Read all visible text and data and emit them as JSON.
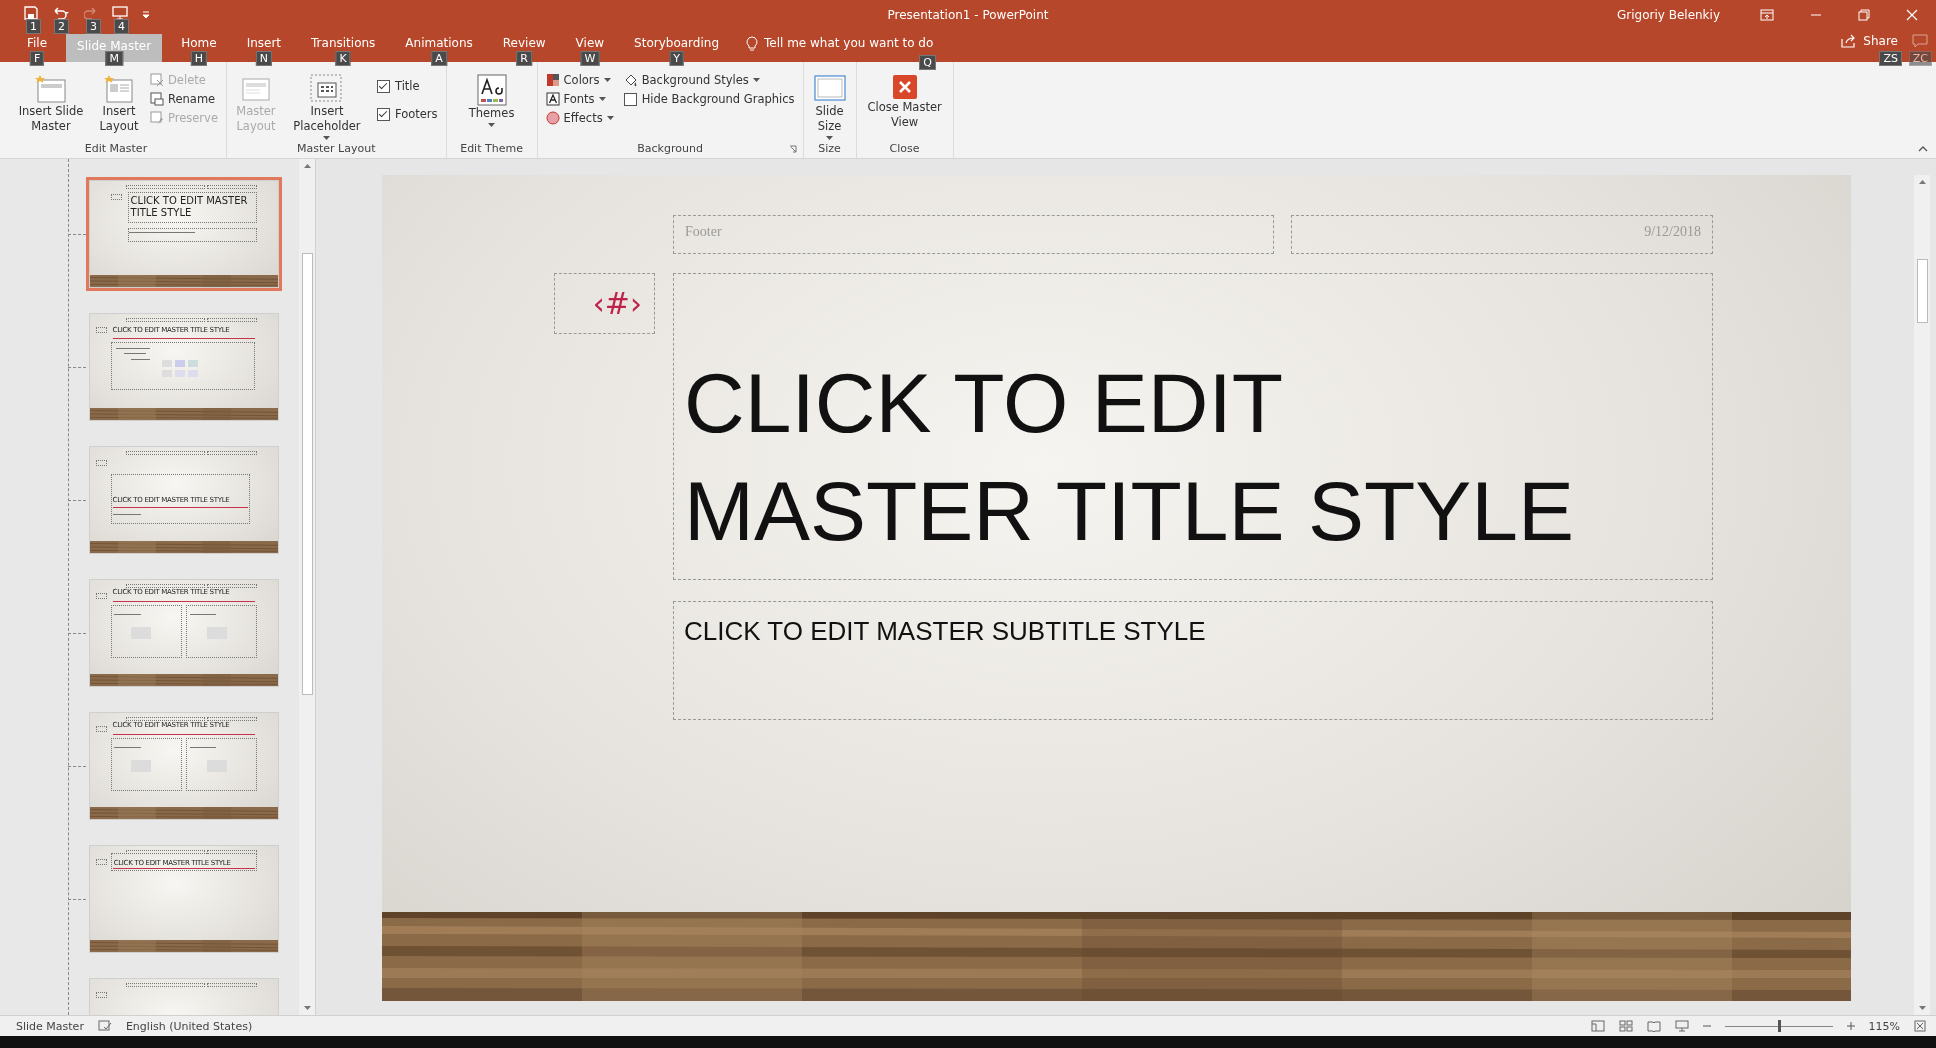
{
  "title_bar": {
    "quick_access": [
      {
        "kind": "save",
        "key_tip": "1",
        "disabled": false
      },
      {
        "kind": "undo",
        "key_tip": "2",
        "disabled": false
      },
      {
        "kind": "redo",
        "key_tip": "3",
        "disabled": true
      },
      {
        "kind": "present",
        "key_tip": "4",
        "disabled": false
      }
    ],
    "title": "Presentation1  -  PowerPoint",
    "user": "Grigoriy Belenkiy"
  },
  "tabs": [
    {
      "label": "File",
      "key_tip": "F",
      "selected": false
    },
    {
      "label": "Slide Master",
      "key_tip": "M",
      "selected": true
    },
    {
      "label": "Home",
      "key_tip": "H",
      "selected": false
    },
    {
      "label": "Insert",
      "key_tip": "N",
      "selected": false
    },
    {
      "label": "Transitions",
      "key_tip": "K",
      "selected": false
    },
    {
      "label": "Animations",
      "key_tip": "A",
      "selected": false
    },
    {
      "label": "Review",
      "key_tip": "R",
      "selected": false
    },
    {
      "label": "View",
      "key_tip": "W",
      "selected": false
    },
    {
      "label": "Storyboarding",
      "key_tip": "Y",
      "selected": false
    }
  ],
  "tell_me": {
    "placeholder": "Tell me what you want to do",
    "key_tip": "Q"
  },
  "share": {
    "label": "Share",
    "key_tip": "ZS"
  },
  "comments": {
    "key_tip": "ZC"
  },
  "ribbon": {
    "edit_master": {
      "label": "Edit Master",
      "insert_slide_master": "Insert Slide Master",
      "insert_layout": "Insert Layout",
      "delete": {
        "label": "Delete",
        "disabled": true
      },
      "rename": {
        "label": "Rename",
        "disabled": false
      },
      "preserve": {
        "label": "Preserve",
        "disabled": true
      }
    },
    "master_layout": {
      "label": "Master Layout",
      "master_layout": {
        "label": "Master Layout",
        "disabled": true
      },
      "insert_placeholder": "Insert Placeholder",
      "title": {
        "label": "Title",
        "checked": true
      },
      "footers": {
        "label": "Footers",
        "checked": true
      }
    },
    "edit_theme": {
      "label": "Edit Theme",
      "themes": "Themes"
    },
    "background": {
      "label": "Background",
      "colors": "Colors",
      "fonts": "Fonts",
      "effects": "Effects",
      "background_styles": "Background Styles",
      "hide_background_graphics": {
        "label": "Hide Background Graphics",
        "checked": false
      }
    },
    "size": {
      "label": "Size",
      "slide_size": "Slide Size"
    },
    "close": {
      "label": "Close",
      "close_master_view": "Close Master View"
    }
  },
  "thumbnails": [
    {
      "kind": "title",
      "title": "CLICK TO EDIT MASTER TITLE STYLE",
      "selected": true
    },
    {
      "kind": "content",
      "title": "CLICK TO EDIT MASTER TITLE STYLE",
      "selected": false
    },
    {
      "kind": "section",
      "title": "CLICK TO EDIT MASTER TITLE STYLE",
      "selected": false
    },
    {
      "kind": "two_content",
      "title": "CLICK TO EDIT MASTER TITLE STYLE",
      "selected": false
    },
    {
      "kind": "comparison",
      "title": "CLICK TO EDIT MASTER TITLE STYLE",
      "selected": false
    },
    {
      "kind": "title_only",
      "title": "CLICK TO EDIT MASTER TITLE STYLE",
      "selected": false
    },
    {
      "kind": "blank",
      "selected": false
    }
  ],
  "slide": {
    "footer": "Footer",
    "date": "9/12/2018",
    "slide_number": "‹#›",
    "title": "CLICK TO EDIT MASTER TITLE STYLE",
    "subtitle": "CLICK TO EDIT MASTER SUBTITLE STYLE"
  },
  "status_bar": {
    "view": "Slide Master",
    "language": "English (United States)",
    "zoom": "115%",
    "zoom_level": {
      "level": 0.5
    }
  }
}
